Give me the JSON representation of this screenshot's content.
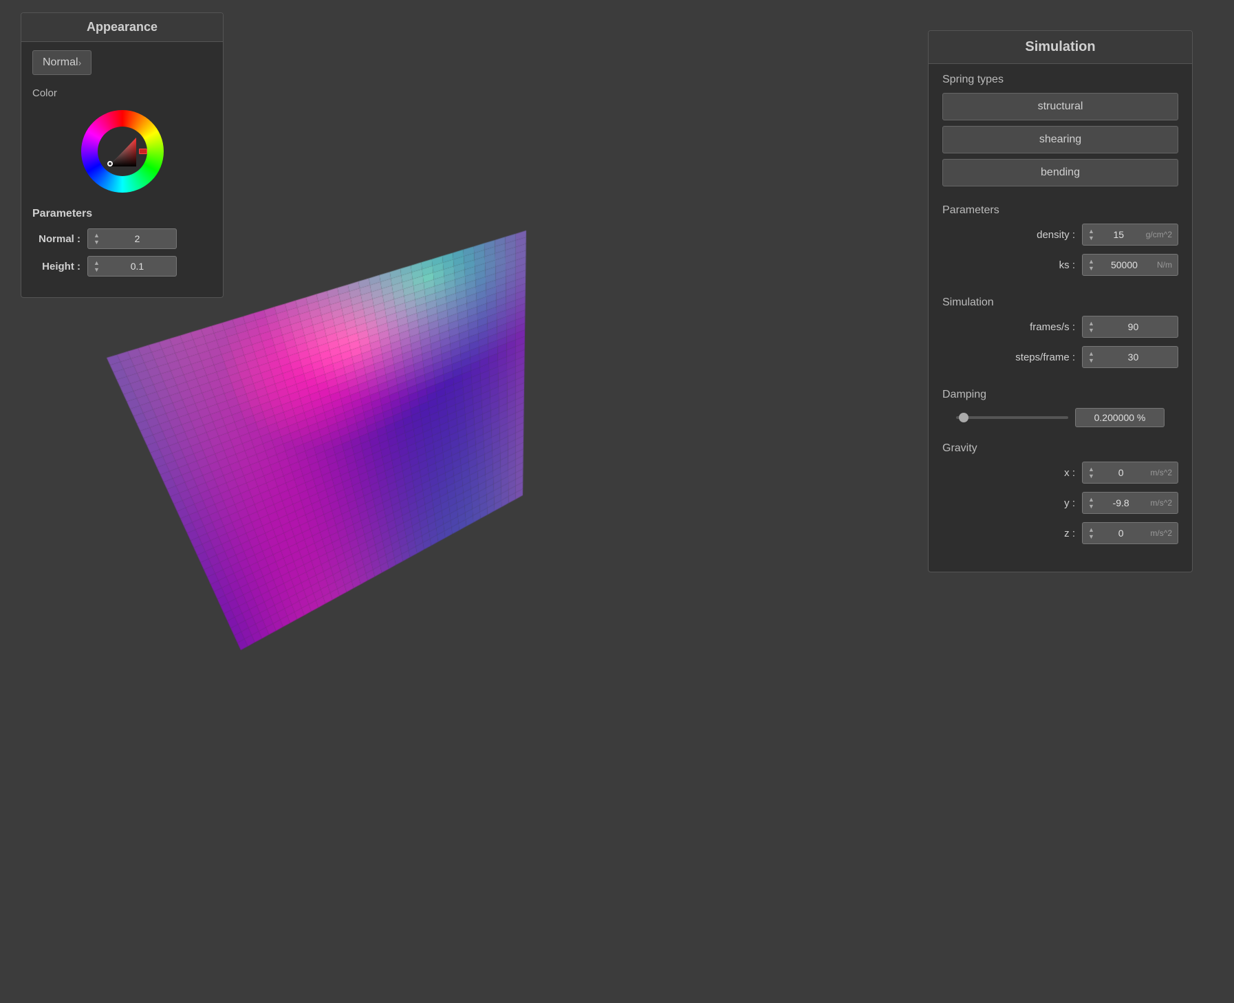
{
  "left_panel": {
    "title": "Appearance",
    "mode_button": "Normal",
    "color_label": "Color",
    "params_title": "Parameters",
    "normal_label": "Normal :",
    "normal_value": "2",
    "height_label": "Height :",
    "height_value": "0.1"
  },
  "right_panel": {
    "title": "Simulation",
    "spring_types_label": "Spring types",
    "structural_btn": "structural",
    "shearing_btn": "shearing",
    "bending_btn": "bending",
    "parameters_label": "Parameters",
    "density_label": "density :",
    "density_value": "15",
    "density_unit": "g/cm^2",
    "ks_label": "ks :",
    "ks_value": "50000",
    "ks_unit": "N/m",
    "simulation_label": "Simulation",
    "frames_label": "frames/s :",
    "frames_value": "90",
    "steps_label": "steps/frame :",
    "steps_value": "30",
    "damping_label": "Damping",
    "damping_value": "0.200000",
    "damping_unit": "%",
    "gravity_label": "Gravity",
    "gx_label": "x :",
    "gx_value": "0",
    "gx_unit": "m/s^2",
    "gy_label": "y :",
    "gy_value": "-9.8",
    "gy_unit": "m/s^2",
    "gz_label": "z :",
    "gz_value": "0",
    "gz_unit": "m/s^2"
  },
  "icons": {
    "chevron": "›",
    "spinner_up": "▲",
    "spinner_down": "▼"
  }
}
